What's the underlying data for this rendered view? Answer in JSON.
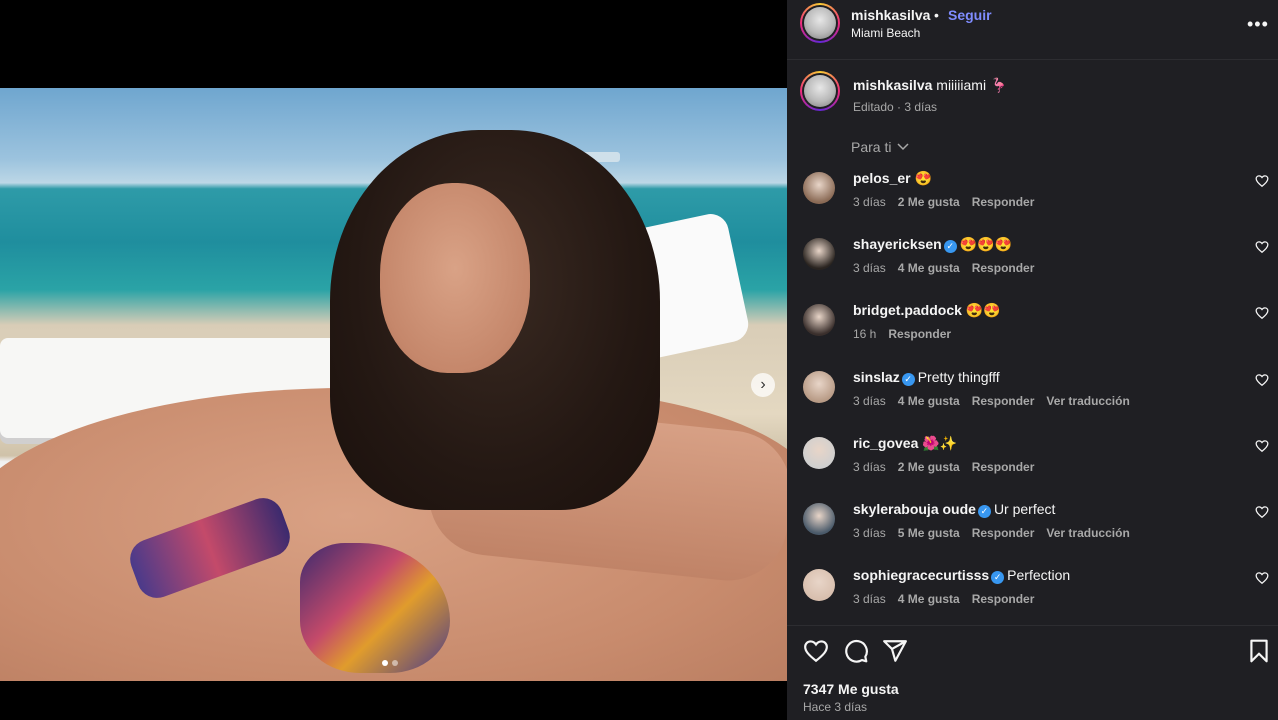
{
  "post": {
    "username": "mishkasilva",
    "separator": "•",
    "follow_label": "Seguir",
    "location": "Miami Beach",
    "more_label": "•••",
    "caption_user": "mishkasilva",
    "caption_text": "miiiiiami 🦩",
    "caption_meta": "Editado · 3 días",
    "carousel_index": 1,
    "carousel_total": 2
  },
  "comments_header": {
    "sort_label": "Para ti"
  },
  "comments": [
    {
      "user": "pelos_er",
      "verified": false,
      "text": "😍",
      "time": "3 días",
      "likes": "2 Me gusta",
      "reply": "Responder",
      "translate": "",
      "avatar_color": "#8a6a55"
    },
    {
      "user": "shayericksen",
      "verified": true,
      "text": "😍😍😍",
      "time": "3 días",
      "likes": "4 Me gusta",
      "reply": "Responder",
      "translate": "",
      "avatar_color": "#2a2420"
    },
    {
      "user": "bridget.paddock",
      "verified": false,
      "text": "😍😍",
      "time": "16 h",
      "likes": "",
      "reply": "Responder",
      "translate": "",
      "avatar_color": "#3a2f2c"
    },
    {
      "user": "sinslaz",
      "verified": true,
      "text": "Pretty thingfff",
      "time": "3 días",
      "likes": "4 Me gusta",
      "reply": "Responder",
      "translate": "Ver traducción",
      "avatar_color": "#b89b86"
    },
    {
      "user": "ric_govea",
      "verified": false,
      "text": "🌺✨",
      "time": "3 días",
      "likes": "2 Me gusta",
      "reply": "Responder",
      "translate": "",
      "avatar_color": "#cfcfcf"
    },
    {
      "user": "skylerabouja oude",
      "verified": true,
      "text": "Ur perfect",
      "time": "3 días",
      "likes": "5 Me gusta",
      "reply": "Responder",
      "translate": "Ver traducción",
      "avatar_color": "#4a5a6a"
    },
    {
      "user": "sophiegracecurtisss",
      "verified": true,
      "text": "Perfection",
      "time": "3 días",
      "likes": "4 Me gusta",
      "reply": "Responder",
      "translate": "",
      "avatar_color": "#d8bfae"
    }
  ],
  "footer": {
    "likes": "7347 Me gusta",
    "when": "Hace 3 días"
  },
  "colors": {
    "panel_bg": "#1f1f23",
    "follow": "#7f8cff",
    "muted": "#a8a8a8",
    "verified": "#3897f0"
  }
}
